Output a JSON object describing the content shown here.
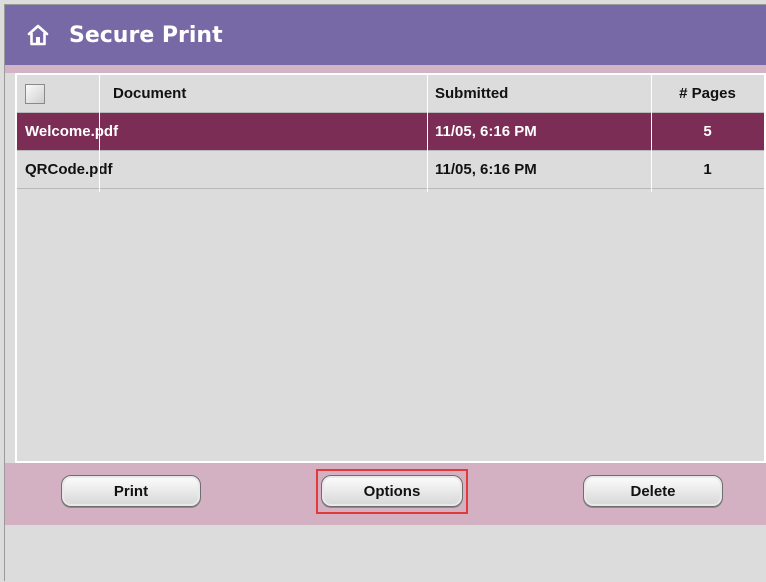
{
  "header": {
    "title": "Secure Print",
    "icon": "home-icon"
  },
  "table": {
    "columns": [
      "Document",
      "Submitted",
      "# Pages"
    ],
    "rows": [
      {
        "document": "Welcome.pdf",
        "submitted": "11/05, 6:16 PM",
        "pages": "5",
        "selected": true
      },
      {
        "document": "QRCode.pdf",
        "submitted": "11/05, 6:16 PM",
        "pages": "1",
        "selected": false
      }
    ]
  },
  "buttons": {
    "print": "Print",
    "options": "Options",
    "delete": "Delete"
  },
  "colors": {
    "header": "#7769a6",
    "selected_row": "#7b2d55",
    "button_bar": "#d3b0c2",
    "highlight": "#e03a3a"
  }
}
